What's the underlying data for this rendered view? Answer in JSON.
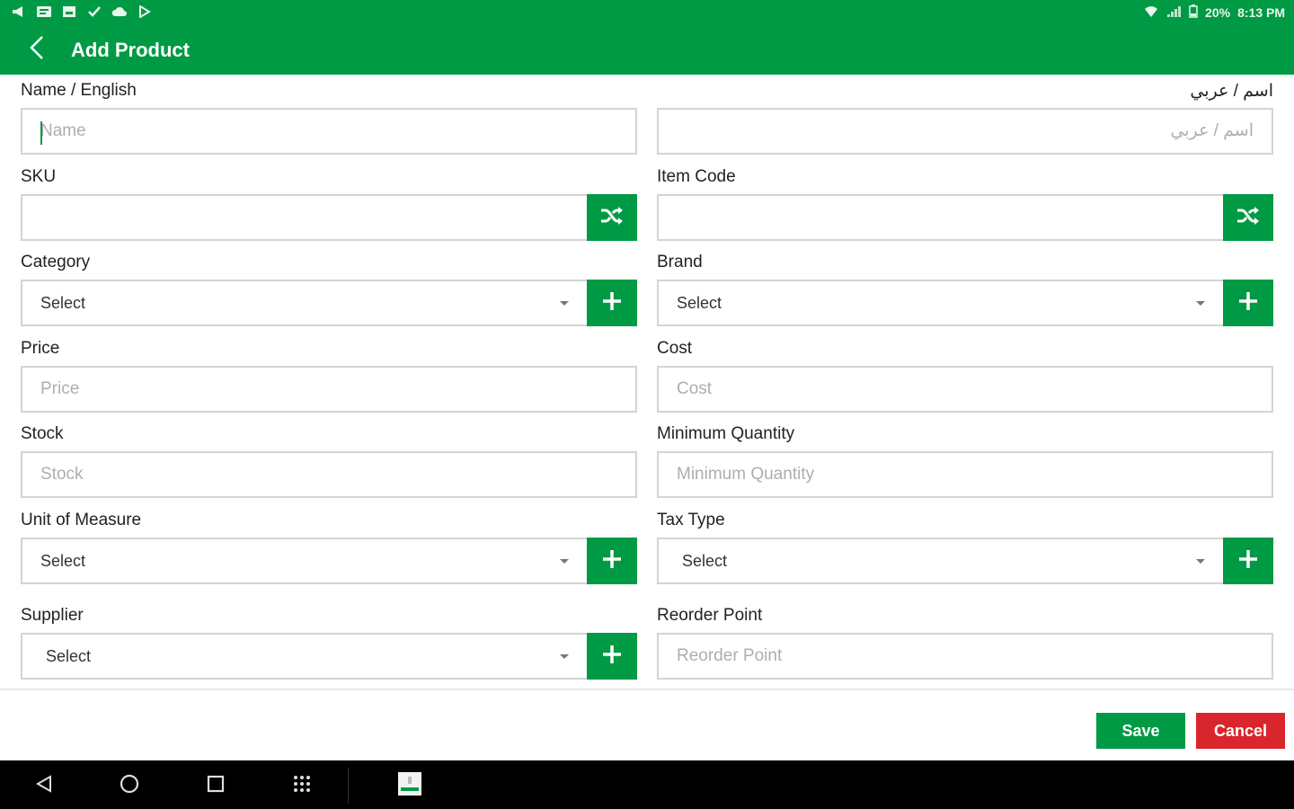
{
  "status_bar": {
    "battery": "20%",
    "time": "8:13 PM"
  },
  "app_bar": {
    "title": "Add Product"
  },
  "form": {
    "name_english": {
      "label": "Name / English",
      "placeholder": "Name"
    },
    "name_arabic": {
      "label": "اسم / عربي",
      "placeholder": "اسم / عربي"
    },
    "sku": {
      "label": "SKU",
      "value": ""
    },
    "item_code": {
      "label": "Item Code",
      "value": ""
    },
    "category": {
      "label": "Category",
      "selected": "Select"
    },
    "brand": {
      "label": "Brand",
      "selected": "Select"
    },
    "price": {
      "label": "Price",
      "placeholder": "Price"
    },
    "cost": {
      "label": "Cost",
      "placeholder": "Cost"
    },
    "stock": {
      "label": "Stock",
      "placeholder": "Stock"
    },
    "minimum_quantity": {
      "label": "Minimum Quantity",
      "placeholder": "Minimum Quantity"
    },
    "unit_of_measure": {
      "label": "Unit of Measure",
      "selected": "Select"
    },
    "tax_type": {
      "label": "Tax Type",
      "selected": "Select"
    },
    "supplier": {
      "label": "Supplier",
      "selected": "Select"
    },
    "reorder_point": {
      "label": "Reorder Point",
      "placeholder": "Reorder Point"
    }
  },
  "actions": {
    "save_label": "Save",
    "cancel_label": "Cancel"
  },
  "icons": {
    "back": "chevron-left-icon",
    "shuffle": "shuffle-icon",
    "add": "plus-icon"
  },
  "colors": {
    "brand_green": "#009a44",
    "cancel_red": "#d9262c",
    "nav_black": "#000000"
  }
}
